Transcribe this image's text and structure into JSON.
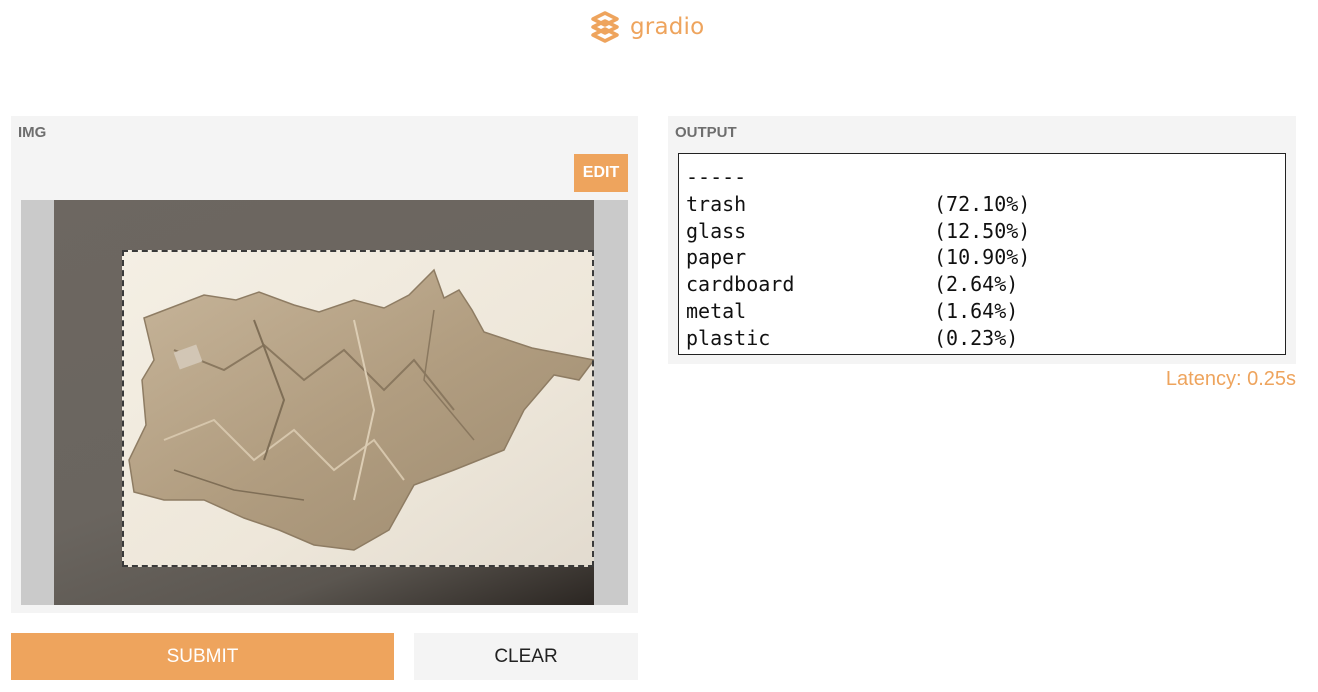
{
  "app": {
    "logo_text": "gradio"
  },
  "input": {
    "label": "IMG",
    "edit_label": "EDIT"
  },
  "output": {
    "label": "OUTPUT",
    "separator": "-----",
    "results": [
      {
        "class": "trash",
        "score": "(72.10%)"
      },
      {
        "class": "glass",
        "score": "(12.50%)"
      },
      {
        "class": "paper",
        "score": "(10.90%)"
      },
      {
        "class": "cardboard",
        "score": "(2.64%)"
      },
      {
        "class": "metal",
        "score": "(1.64%)"
      },
      {
        "class": "plastic",
        "score": "(0.23%)"
      }
    ],
    "latency": "Latency: 0.25s"
  },
  "actions": {
    "submit_label": "SUBMIT",
    "clear_label": "CLEAR"
  },
  "colors": {
    "accent": "#eea45d",
    "panel_bg": "#f4f4f4"
  }
}
